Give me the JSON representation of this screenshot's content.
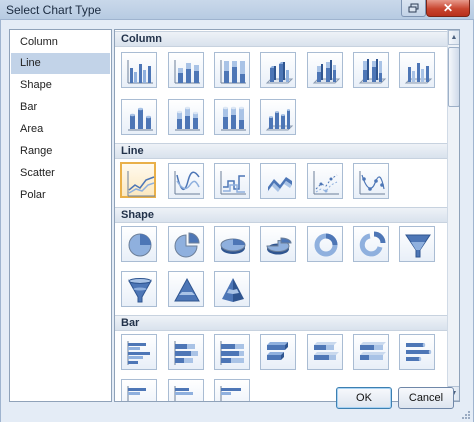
{
  "window": {
    "title": "Select Chart Type"
  },
  "categories": [
    {
      "label": "Column",
      "selected": false
    },
    {
      "label": "Line",
      "selected": true
    },
    {
      "label": "Shape",
      "selected": false
    },
    {
      "label": "Bar",
      "selected": false
    },
    {
      "label": "Area",
      "selected": false
    },
    {
      "label": "Range",
      "selected": false
    },
    {
      "label": "Scatter",
      "selected": false
    },
    {
      "label": "Polar",
      "selected": false
    }
  ],
  "sections": {
    "column": {
      "label": "Column"
    },
    "line": {
      "label": "Line"
    },
    "shape": {
      "label": "Shape"
    },
    "bar": {
      "label": "Bar"
    }
  },
  "selected_chart": "line-chart-icon",
  "buttons": {
    "ok": "OK",
    "cancel": "Cancel"
  },
  "colors": {
    "accent": "#e9b049",
    "selection": "#c2d3e8",
    "icon_blue": "#4d76b6"
  }
}
